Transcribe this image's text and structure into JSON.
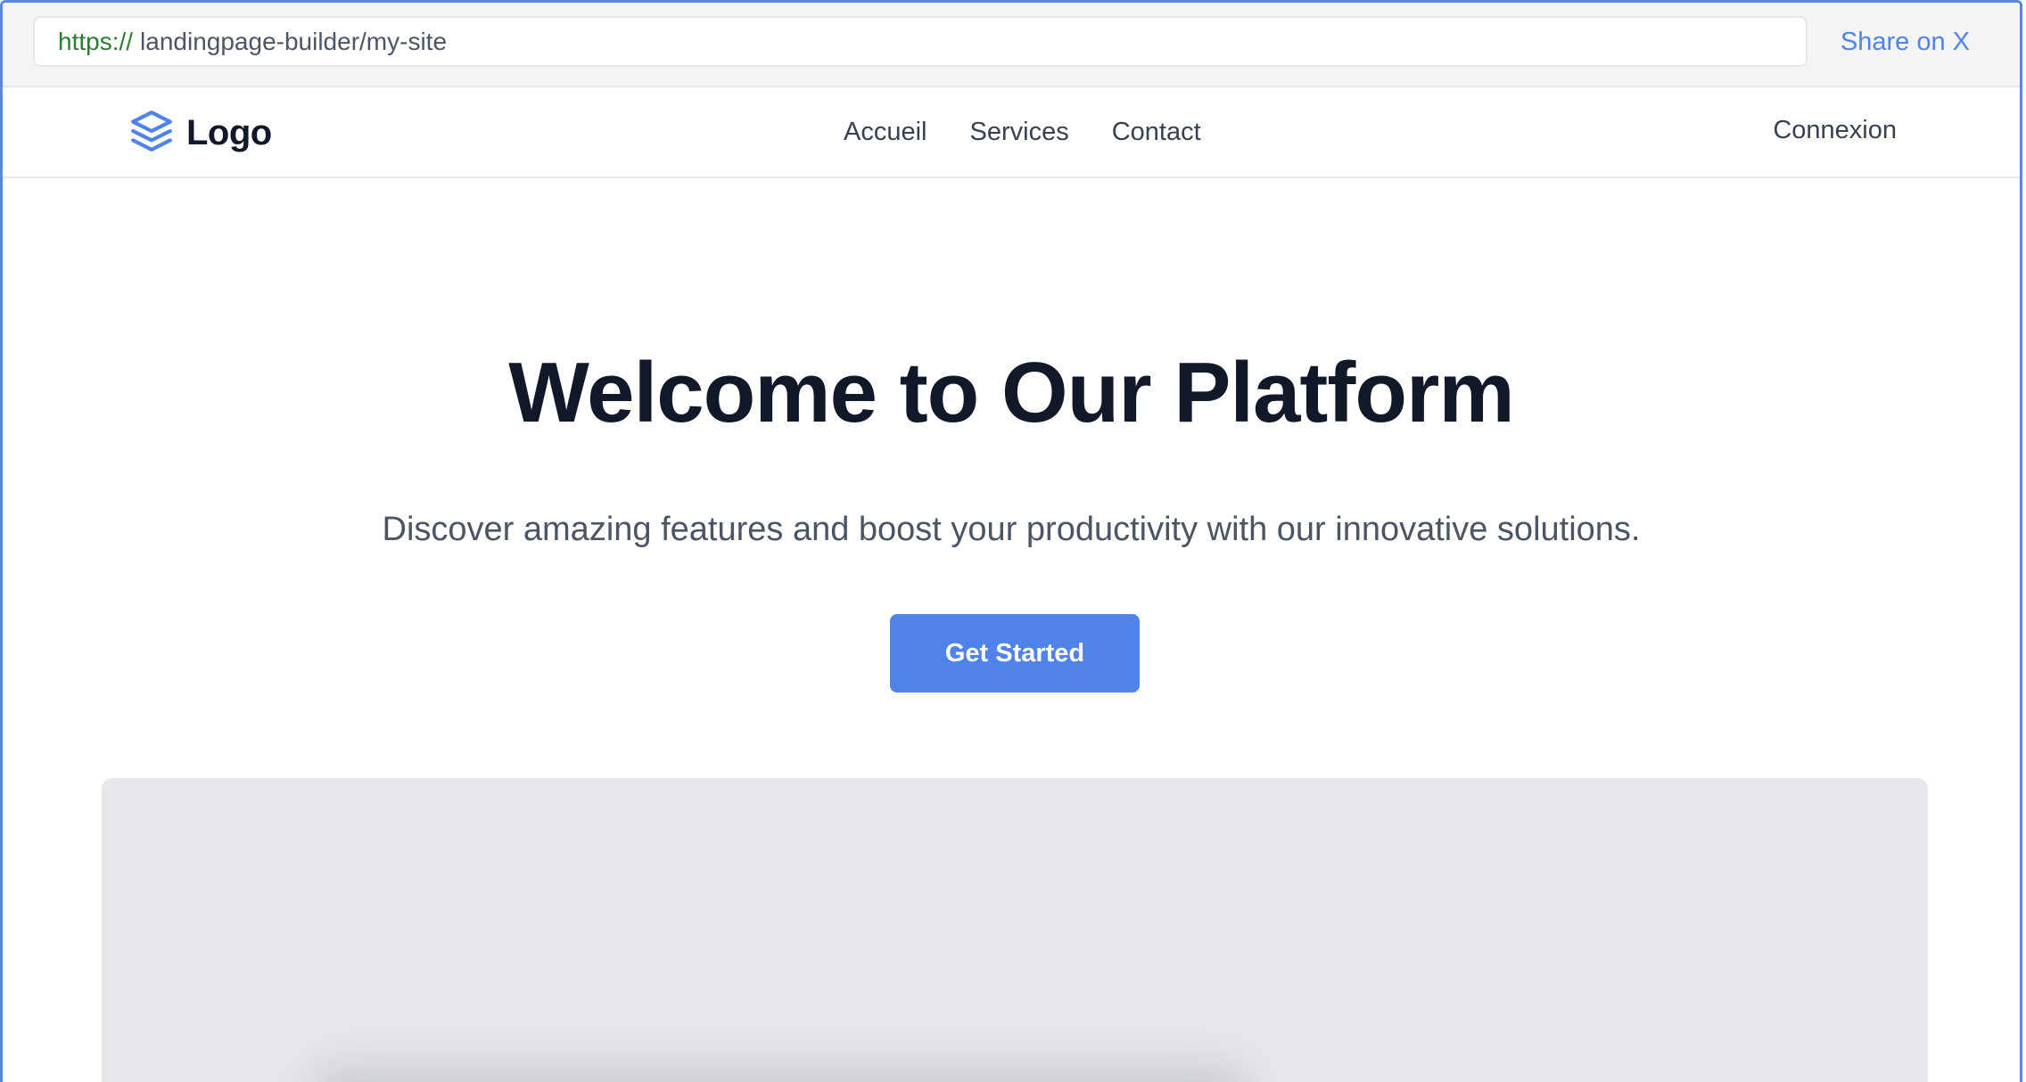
{
  "browser": {
    "url_scheme": "https://",
    "url_path": "landingpage-builder/my-site",
    "share_label": "Share on X"
  },
  "navbar": {
    "logo_text": "Logo",
    "logo_icon": "layers-icon",
    "links": [
      "Accueil",
      "Services",
      "Contact"
    ],
    "login_label": "Connexion"
  },
  "hero": {
    "title": "Welcome to Our Platform",
    "subtitle": "Discover amazing features and boost your productivity with our innovative solutions.",
    "cta_label": "Get Started"
  },
  "colors": {
    "accent": "#4f83ea",
    "heading": "#111827",
    "body_text": "#4b5563",
    "url_scheme": "#2e7d32",
    "placeholder_bg": "#e5e7eb"
  }
}
